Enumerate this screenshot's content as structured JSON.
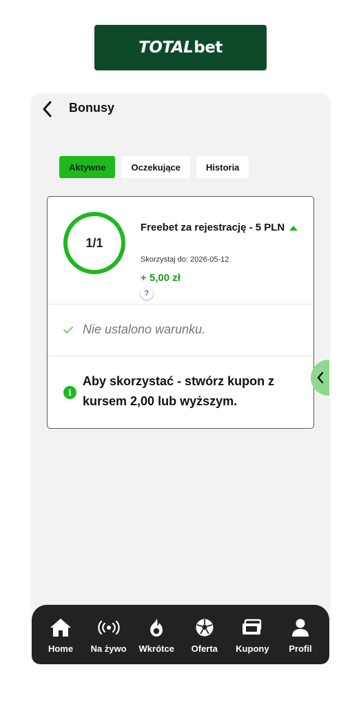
{
  "brand": {
    "logo_main": "TOTAL",
    "logo_suffix": "bet",
    "logo_bg": "#0e4a2a"
  },
  "header": {
    "title": "Bonusy"
  },
  "tabs": [
    {
      "label": "Aktywne",
      "active": true
    },
    {
      "label": "Oczekujące",
      "active": false
    },
    {
      "label": "Historia",
      "active": false
    }
  ],
  "bonus": {
    "progress_label": "1/1",
    "progress": 1.0,
    "title": "Freebet za rejestrację - 5 PLN",
    "expiry": "Skorzystaj do: 2026-05-12",
    "amount": "+ 5,00 zł",
    "help": "?",
    "condition": "Nie ustalono warunku.",
    "info_icon": "i",
    "info": "Aby skorzystać - stwórz kupon z kursem 2,00 lub wyższym."
  },
  "colors": {
    "accent": "#1db91d",
    "amount": "#1f9e1f",
    "nav_bg": "#222222"
  },
  "nav": [
    {
      "label": "Home",
      "icon": "home-icon"
    },
    {
      "label": "Na żywo",
      "icon": "live-icon"
    },
    {
      "label": "Wkrótce",
      "icon": "flame-icon"
    },
    {
      "label": "Oferta",
      "icon": "ball-icon"
    },
    {
      "label": "Kupony",
      "icon": "coupon-icon"
    },
    {
      "label": "Profil",
      "icon": "profile-icon"
    }
  ]
}
